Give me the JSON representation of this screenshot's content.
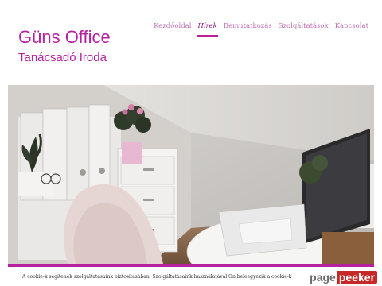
{
  "brand": {
    "title": "Güns Office",
    "subtitle": "Tanácsadó Iroda",
    "color": "#b5219f"
  },
  "nav": {
    "items": [
      {
        "label": "Kezdőoldal",
        "active": false
      },
      {
        "label": "Hírek",
        "active": true
      },
      {
        "label": "Bemutatkozás",
        "active": false
      },
      {
        "label": "Szolgáltatások",
        "active": false
      },
      {
        "label": "Kapcsolat",
        "active": false
      }
    ]
  },
  "hero": {
    "description_icon": "office-photo"
  },
  "cookie": {
    "text": "A cookie-k segítenek szolgáltatásaink biztosításában. Szolgáltatásaink használatával Ön beleegyezik a cookie-k használatába."
  },
  "badge": {
    "part1": "page",
    "part2": "peeker"
  }
}
